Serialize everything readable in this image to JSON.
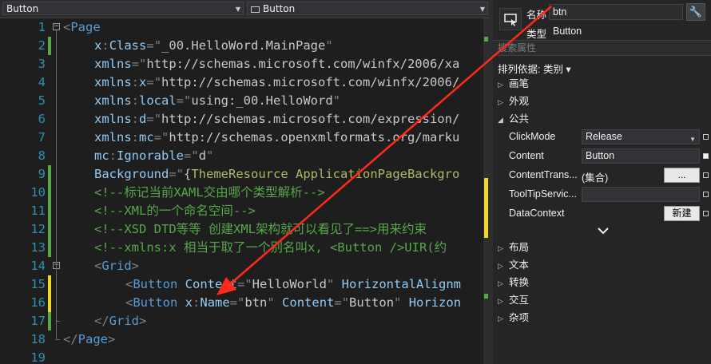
{
  "editor": {
    "nav_left": "Button",
    "nav_right": "Button",
    "lines": [
      {
        "num": "1",
        "tokens": [
          {
            "t": "<",
            "c": "punct"
          },
          {
            "t": "Page",
            "c": "tag"
          }
        ],
        "indent": 0,
        "mark": "",
        "fold": "-"
      },
      {
        "num": "2",
        "tokens": [
          {
            "t": "x",
            "c": "attr"
          },
          {
            "t": ":",
            "c": "punct"
          },
          {
            "t": "Class",
            "c": "attr"
          },
          {
            "t": "=\"",
            "c": "punct"
          },
          {
            "t": "_00.HelloWord.MainPage",
            "c": "val"
          },
          {
            "t": "\"",
            "c": "punct"
          }
        ],
        "indent": 2,
        "mark": "g"
      },
      {
        "num": "3",
        "tokens": [
          {
            "t": "xmlns",
            "c": "attr"
          },
          {
            "t": "=\"",
            "c": "punct"
          },
          {
            "t": "http://schemas.microsoft.com/winfx/2006/xa",
            "c": "val"
          }
        ],
        "indent": 2,
        "mark": ""
      },
      {
        "num": "4",
        "tokens": [
          {
            "t": "xmlns",
            "c": "attr"
          },
          {
            "t": ":",
            "c": "punct"
          },
          {
            "t": "x",
            "c": "attr"
          },
          {
            "t": "=\"",
            "c": "punct"
          },
          {
            "t": "http://schemas.microsoft.com/winfx/2006/",
            "c": "val"
          }
        ],
        "indent": 2,
        "mark": ""
      },
      {
        "num": "5",
        "tokens": [
          {
            "t": "xmlns",
            "c": "attr"
          },
          {
            "t": ":",
            "c": "punct"
          },
          {
            "t": "local",
            "c": "attr"
          },
          {
            "t": "=\"",
            "c": "punct"
          },
          {
            "t": "using:_00.HelloWord",
            "c": "val"
          },
          {
            "t": "\"",
            "c": "punct"
          }
        ],
        "indent": 2,
        "mark": ""
      },
      {
        "num": "6",
        "tokens": [
          {
            "t": "xmlns",
            "c": "attr"
          },
          {
            "t": ":",
            "c": "punct"
          },
          {
            "t": "d",
            "c": "attr"
          },
          {
            "t": "=\"",
            "c": "punct"
          },
          {
            "t": "http://schemas.microsoft.com/expression/",
            "c": "val"
          }
        ],
        "indent": 2,
        "mark": ""
      },
      {
        "num": "7",
        "tokens": [
          {
            "t": "xmlns",
            "c": "attr"
          },
          {
            "t": ":",
            "c": "punct"
          },
          {
            "t": "mc",
            "c": "attr"
          },
          {
            "t": "=\"",
            "c": "punct"
          },
          {
            "t": "http://schemas.openxmlformats.org/marku",
            "c": "val"
          }
        ],
        "indent": 2,
        "mark": ""
      },
      {
        "num": "8",
        "tokens": [
          {
            "t": "mc",
            "c": "attr"
          },
          {
            "t": ":",
            "c": "punct"
          },
          {
            "t": "Ignorable",
            "c": "attr"
          },
          {
            "t": "=\"",
            "c": "punct"
          },
          {
            "t": "d",
            "c": "val"
          },
          {
            "t": "\"",
            "c": "punct"
          }
        ],
        "indent": 2,
        "mark": ""
      },
      {
        "num": "9",
        "tokens": [
          {
            "t": "Background",
            "c": "attr"
          },
          {
            "t": "=\"",
            "c": "punct"
          },
          {
            "t": "{",
            "c": "val"
          },
          {
            "t": "ThemeResource",
            "c": "themeres"
          },
          {
            "t": " ApplicationPageBackgro",
            "c": "themeres"
          }
        ],
        "indent": 2,
        "mark": "g"
      },
      {
        "num": "10",
        "tokens": [
          {
            "t": "<!--标记当前XAML交由哪个类型解析-->",
            "c": "comment"
          }
        ],
        "indent": 2,
        "mark": "g"
      },
      {
        "num": "11",
        "tokens": [
          {
            "t": "<!--XML的一个命名空间-->",
            "c": "comment"
          }
        ],
        "indent": 2,
        "mark": "g"
      },
      {
        "num": "12",
        "tokens": [
          {
            "t": "<!--XSD DTD等等 创建XML架构就可以看见了==>用来约束",
            "c": "comment"
          }
        ],
        "indent": 2,
        "mark": "g"
      },
      {
        "num": "13",
        "tokens": [
          {
            "t": "<!--xmlns:x 相当于取了一个别名叫x, <Button />UIR(约",
            "c": "comment"
          }
        ],
        "indent": 2,
        "mark": "g"
      },
      {
        "num": "14",
        "tokens": [
          {
            "t": "<",
            "c": "punct"
          },
          {
            "t": "Grid",
            "c": "tag"
          },
          {
            "t": ">",
            "c": "punct"
          }
        ],
        "indent": 2,
        "mark": "",
        "fold": "-"
      },
      {
        "num": "15",
        "tokens": [
          {
            "t": "<",
            "c": "punct"
          },
          {
            "t": "Button",
            "c": "tag"
          },
          {
            "t": " Content",
            "c": "attr"
          },
          {
            "t": "=\"",
            "c": "punct"
          },
          {
            "t": "HelloWorld",
            "c": "val"
          },
          {
            "t": "\" ",
            "c": "punct"
          },
          {
            "t": "HorizontalAlignm",
            "c": "attr"
          }
        ],
        "indent": 4,
        "mark": "y"
      },
      {
        "num": "16",
        "tokens": [
          {
            "t": "<",
            "c": "punct"
          },
          {
            "t": "Button",
            "c": "tag"
          },
          {
            "t": " x",
            "c": "attr"
          },
          {
            "t": ":",
            "c": "punct"
          },
          {
            "t": "Name",
            "c": "attr"
          },
          {
            "t": "=\"",
            "c": "punct"
          },
          {
            "t": "btn",
            "c": "val"
          },
          {
            "t": "\" ",
            "c": "punct"
          },
          {
            "t": "Content",
            "c": "attr"
          },
          {
            "t": "=\"",
            "c": "punct"
          },
          {
            "t": "Button",
            "c": "val"
          },
          {
            "t": "\" ",
            "c": "punct"
          },
          {
            "t": "Horizon",
            "c": "attr"
          }
        ],
        "indent": 4,
        "mark": "y"
      },
      {
        "num": "17",
        "tokens": [
          {
            "t": "</",
            "c": "punct"
          },
          {
            "t": "Grid",
            "c": "tag"
          },
          {
            "t": ">",
            "c": "punct"
          }
        ],
        "indent": 2,
        "mark": "g"
      },
      {
        "num": "18",
        "tokens": [
          {
            "t": "</",
            "c": "punct"
          },
          {
            "t": "Page",
            "c": "tag"
          },
          {
            "t": ">",
            "c": "punct"
          }
        ],
        "indent": 0,
        "mark": ""
      },
      {
        "num": "19",
        "tokens": [],
        "indent": 0,
        "mark": ""
      }
    ]
  },
  "properties": {
    "name_label": "名称",
    "name_value": "btn",
    "type_label": "类型",
    "type_value": "Button",
    "search_placeholder": "搜索属性",
    "sort_by": "排列依据: 类别 ▾",
    "categories_top": [
      {
        "label": "画笔",
        "expanded": false
      },
      {
        "label": "外观",
        "expanded": false
      },
      {
        "label": "公共",
        "expanded": true
      }
    ],
    "common_props": [
      {
        "name": "ClickMode",
        "value": "Release",
        "kind": "dropdown"
      },
      {
        "name": "Content",
        "value": "Button",
        "kind": "text",
        "filled": true
      },
      {
        "name": "ContentTrans...",
        "value": "(集合)",
        "kind": "collection",
        "button": "..."
      },
      {
        "name": "ToolTipServic...",
        "value": "",
        "kind": "text"
      },
      {
        "name": "DataContext",
        "value": "",
        "kind": "new",
        "button": "新建"
      }
    ],
    "categories_bottom": [
      {
        "label": "布局"
      },
      {
        "label": "文本"
      },
      {
        "label": "转换"
      },
      {
        "label": "交互"
      },
      {
        "label": "杂项"
      }
    ]
  },
  "colors": {
    "annotation_arrow": "#ff2a1a",
    "accent": "#007acc"
  }
}
